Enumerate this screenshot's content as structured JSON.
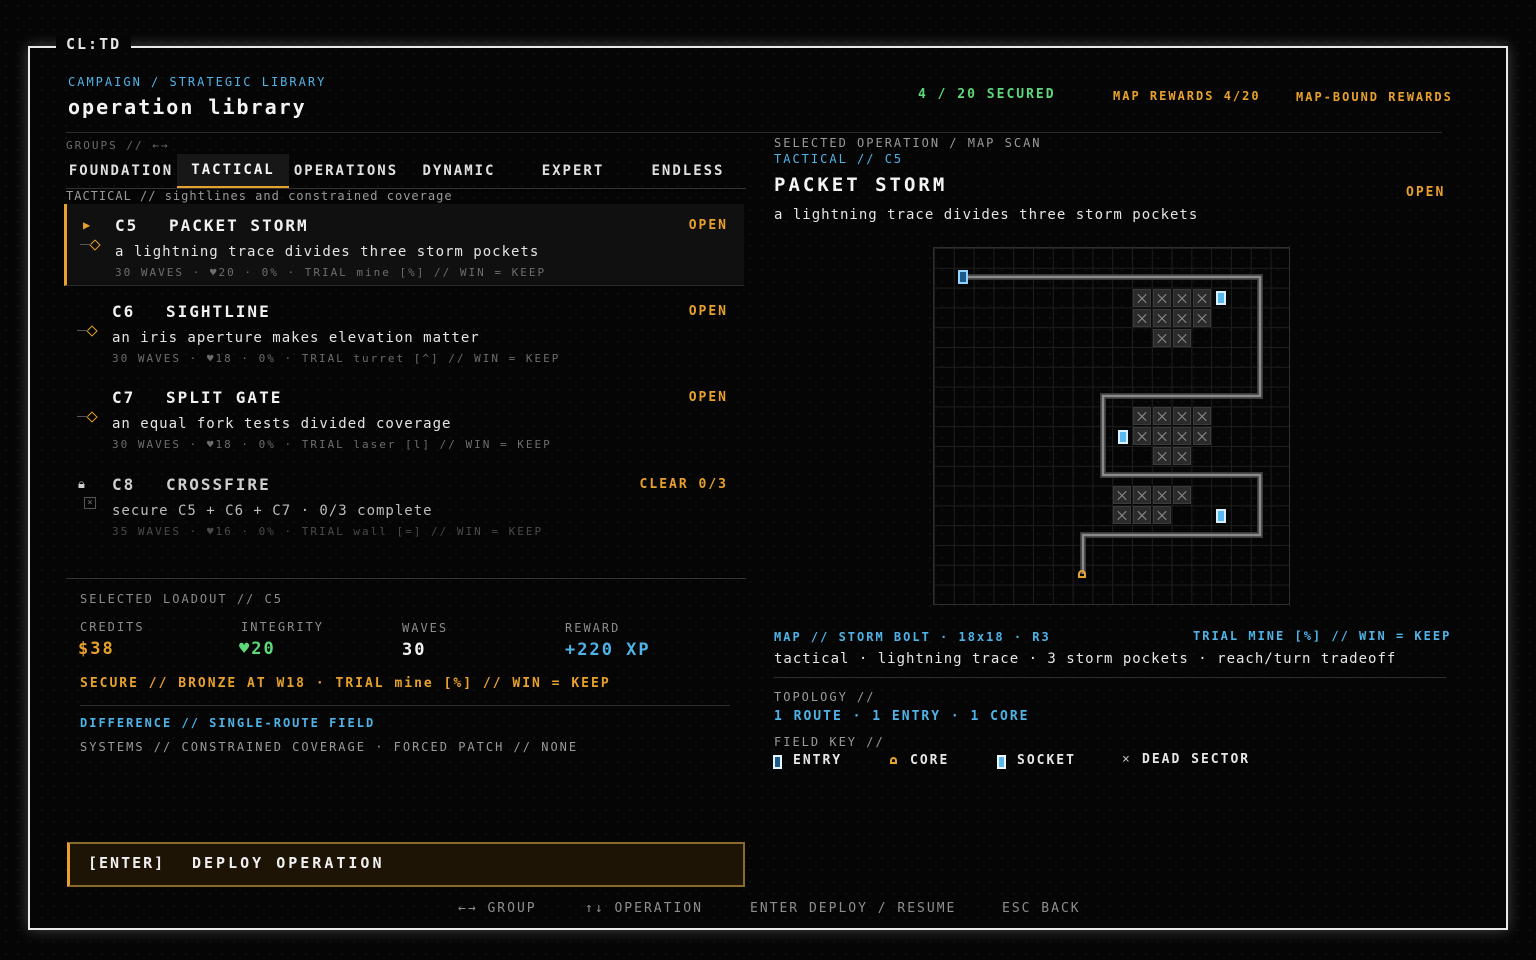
{
  "app": {
    "title": "CL:TD"
  },
  "header": {
    "breadcrumb": "CAMPAIGN / STRATEGIC LIBRARY",
    "title": "operation library",
    "secured": "4 / 20 SECURED",
    "map_rewards": "MAP REWARDS 4/20",
    "map_bound": "MAP-BOUND REWARDS"
  },
  "groups": {
    "label": "GROUPS // ←→",
    "tabs": [
      {
        "label": "FOUNDATION",
        "active": false
      },
      {
        "label": "TACTICAL",
        "active": true
      },
      {
        "label": "OPERATIONS",
        "active": false
      },
      {
        "label": "DYNAMIC",
        "active": false
      },
      {
        "label": "EXPERT",
        "active": false
      },
      {
        "label": "ENDLESS",
        "active": false
      }
    ],
    "subtitle": "TACTICAL // sightlines and constrained coverage"
  },
  "operations": [
    {
      "code": "C5",
      "name": "PACKET STORM",
      "status": "OPEN",
      "desc": "a lightning trace divides three storm pockets",
      "meta": "30 WAVES  ·  ♥20  ·  0%  ·  TRIAL mine [%] // WIN = KEEP",
      "selected": true,
      "locked": false
    },
    {
      "code": "C6",
      "name": "SIGHTLINE",
      "status": "OPEN",
      "desc": "an iris aperture makes elevation matter",
      "meta": "30 WAVES  ·  ♥18  ·  0%  ·  TRIAL turret [^] // WIN = KEEP",
      "selected": false,
      "locked": false
    },
    {
      "code": "C7",
      "name": "SPLIT GATE",
      "status": "OPEN",
      "desc": "an equal fork tests divided coverage",
      "meta": "30 WAVES  ·  ♥18  ·  0%  ·  TRIAL laser [l] // WIN = KEEP",
      "selected": false,
      "locked": false
    },
    {
      "code": "C8",
      "name": "CROSSFIRE",
      "status": "CLEAR 0/3",
      "desc": "secure C5 + C6 + C7 · 0/3 complete",
      "meta": "35 WAVES  ·  ♥16  ·  0%  ·  TRIAL wall [=] // WIN = KEEP",
      "selected": false,
      "locked": true
    }
  ],
  "loadout": {
    "label": "SELECTED LOADOUT // C5",
    "credits_label": "CREDITS",
    "credits": "$38",
    "integrity_label": "INTEGRITY",
    "integrity": "♥20",
    "waves_label": "WAVES",
    "waves": "30",
    "reward_label": "REWARD",
    "reward": "+220 XP",
    "secure_line": "SECURE // BRONZE AT W18  ·  TRIAL mine [%] // WIN = KEEP",
    "difference": "DIFFERENCE // SINGLE-ROUTE FIELD",
    "systems": "SYSTEMS // CONSTRAINED COVERAGE  ·  FORCED PATCH // NONE"
  },
  "deploy": {
    "key": "[ENTER]",
    "label": "DEPLOY OPERATION"
  },
  "footer": {
    "hints": [
      "←→ GROUP",
      "↑↓ OPERATION",
      "ENTER DEPLOY / RESUME",
      "ESC BACK"
    ]
  },
  "detail": {
    "label": "SELECTED OPERATION / MAP SCAN",
    "sub": "TACTICAL // C5",
    "title": "PACKET STORM",
    "status": "OPEN",
    "desc": "a lightning trace divides three storm pockets",
    "map_line": "MAP // STORM BOLT  ·  18x18  ·  R3",
    "trial_line": "TRIAL MINE [%] // WIN = KEEP",
    "tags": "tactical · lightning trace · 3 storm pockets · reach/turn tradeoff",
    "topology_label": "TOPOLOGY //",
    "topology": "1 ROUTE  ·  1 ENTRY  ·  1 CORE",
    "fieldkey_label": "FIELD KEY //",
    "key_entry": "ENTRY",
    "key_core": "CORE",
    "key_socket": "SOCKET",
    "key_dead": "DEAD SECTOR"
  },
  "colors": {
    "accent": "#e8a12c",
    "blue": "#4fb3e8",
    "green": "#5dd87a"
  }
}
